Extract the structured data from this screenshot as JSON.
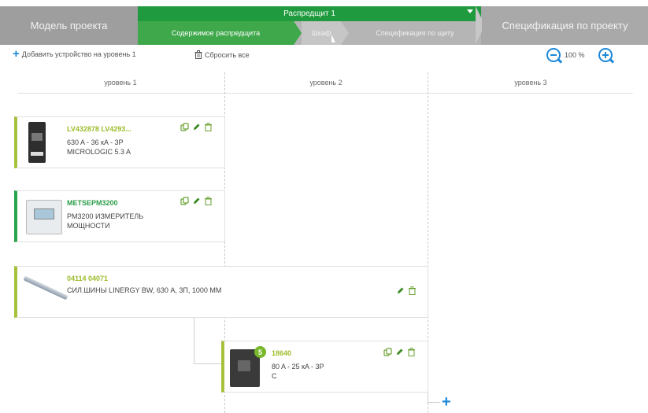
{
  "nav": {
    "model": "Модель проекта",
    "group_title": "Распредщит 1",
    "sub_content": "Содержимое распредщита",
    "sub_shkaf": "Шкаф",
    "sub_spec_shield": "Спецификация по щиту",
    "spec_project": "Спецификация по проекту"
  },
  "toolbar": {
    "add_label": "Добавить устройство на уровень 1",
    "reset_label": "Сбросить все",
    "zoom_level": "100 %"
  },
  "levels": [
    "уровень 1",
    "уровень 2",
    "уровень 3"
  ],
  "cards": [
    {
      "code": "LV432878 LV4293...",
      "desc_line1": "630 A - 36 кA - 3P",
      "desc_line2": "MICROLOGIC 5.3 A"
    },
    {
      "code": "METSEPM3200",
      "desc_line1": "PM3200 ИЗМЕРИТЕЛЬ",
      "desc_line2": "МОЩНОСТИ"
    },
    {
      "code": "04114 04071",
      "desc_line1": "СИЛ.ШИНЫ LINERGY BW, 630 А, 3П, 1000 ММ"
    },
    {
      "code": "18640",
      "badge": "5",
      "desc_line1": "80 A - 25 кA - 3P",
      "desc_line2": "C"
    }
  ],
  "colors": {
    "accent_green": "#1f9a3e",
    "code_green": "#9cbc2a",
    "blue": "#1e88d6"
  }
}
